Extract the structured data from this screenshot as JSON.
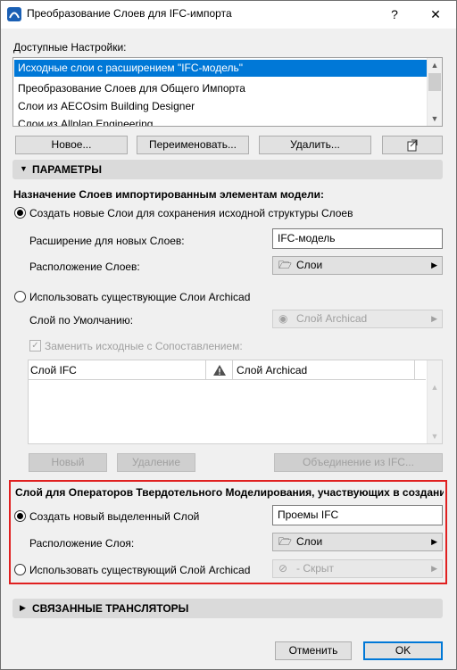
{
  "window": {
    "title": "Преобразование Слоев для IFC-импорта",
    "help_label": "?",
    "close_label": "✕"
  },
  "presets": {
    "header": "Доступные Настройки:",
    "items": [
      "Исходные слои с расширением \"IFC-модель\"",
      "Преобразование Слоев для Общего Импорта",
      "Слои из AECOsim Building Designer",
      "Слои из Allplan Engineering"
    ],
    "selected_index": 0,
    "buttons": {
      "new": "Новое...",
      "rename": "Переименовать...",
      "delete": "Удалить..."
    }
  },
  "params": {
    "header": "ПАРАМЕТРЫ",
    "assign_title": "Назначение Слоев импортированным элементам модели:",
    "opt_create": "Создать новые Слои для сохранения исходной структуры Слоев",
    "extension_label": "Расширение для новых Слоев:",
    "extension_value": "IFC-модель",
    "location_label": "Расположение Слоев:",
    "location_value": "Слои",
    "opt_existing": "Использовать существующие Слои Archicad",
    "default_layer_label": "Слой по Умолчанию:",
    "default_layer_value": "Слой Archicad",
    "replace_label": "Заменить исходные с Сопоставлением:",
    "table": {
      "col_ifc": "Слой IFC",
      "col_archicad": "Слой Archicad"
    },
    "btn_new": "Новый",
    "btn_delete": "Удаление",
    "btn_merge": "Объединение из IFC..."
  },
  "solid_ops": {
    "title": "Слой для Операторов Твердотельного Моделирования, участвующих в создании прое",
    "opt_create": "Создать новый выделенный Слой",
    "layer_name": "Проемы IFC",
    "location_label": "Расположение Слоя:",
    "location_value": "Слои",
    "opt_existing": "Использовать существующий Слой Archicad",
    "existing_value": "- Скрыт"
  },
  "translators": {
    "header": "СВЯЗАННЫЕ ТРАНСЛЯТОРЫ"
  },
  "footer": {
    "cancel": "Отменить",
    "ok": "OK"
  }
}
